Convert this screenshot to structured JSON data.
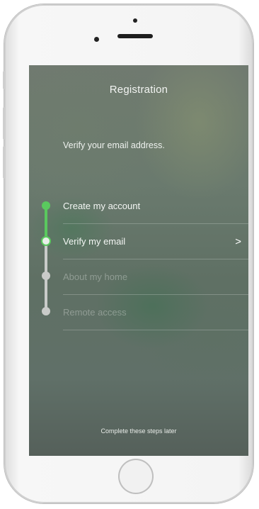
{
  "screen": {
    "title": "Registration",
    "subtitle": "Verify your email address.",
    "steps": [
      {
        "label": "Create my account",
        "state": "done"
      },
      {
        "label": "Verify my email",
        "state": "active",
        "chevron": ">"
      },
      {
        "label": "About my home",
        "state": "pending"
      },
      {
        "label": "Remote access",
        "state": "pending"
      }
    ],
    "footer_link": "Complete these steps later"
  },
  "colors": {
    "progress_green": "#5ac95e",
    "pending_gray": "#c9cbc9"
  }
}
